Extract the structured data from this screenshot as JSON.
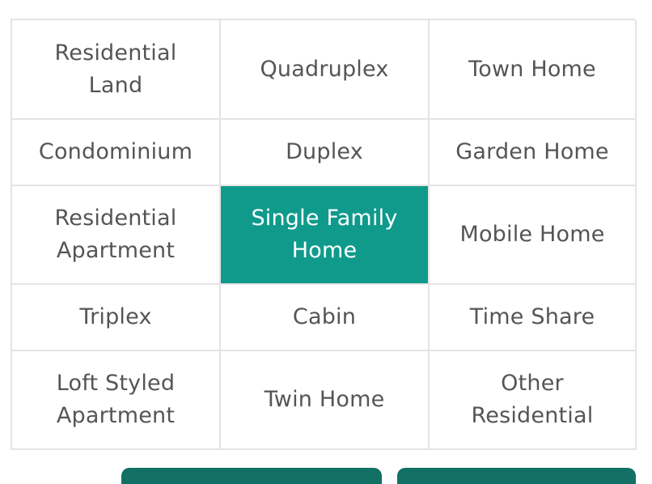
{
  "colors": {
    "accent": "#0f9a8c",
    "button": "#127064"
  },
  "property_types": [
    {
      "label": "Residential\nLand",
      "selected": false
    },
    {
      "label": "Quadruplex",
      "selected": false
    },
    {
      "label": "Town Home",
      "selected": false
    },
    {
      "label": "Condominium",
      "selected": false
    },
    {
      "label": "Duplex",
      "selected": false
    },
    {
      "label": "Garden Home",
      "selected": false
    },
    {
      "label": "Residential\nApartment",
      "selected": false
    },
    {
      "label": "Single Family\nHome",
      "selected": true
    },
    {
      "label": "Mobile Home",
      "selected": false
    },
    {
      "label": "Triplex",
      "selected": false
    },
    {
      "label": "Cabin",
      "selected": false
    },
    {
      "label": "Time Share",
      "selected": false
    },
    {
      "label": "Loft Styled\nApartment",
      "selected": false
    },
    {
      "label": "Twin Home",
      "selected": false
    },
    {
      "label": "Other\nResidential",
      "selected": false
    }
  ]
}
